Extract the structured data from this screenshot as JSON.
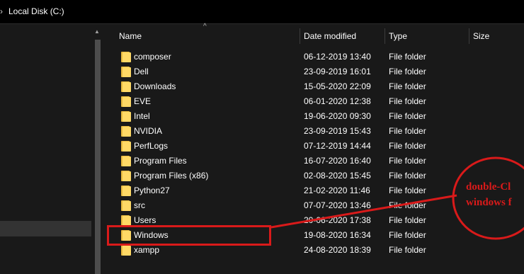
{
  "breadcrumb": {
    "chevron": "›",
    "location": "Local Disk (C:)"
  },
  "columns": {
    "name": "Name",
    "date_modified": "Date modified",
    "type": "Type",
    "size": "Size",
    "sort_indicator": "^"
  },
  "rows": [
    {
      "name": "composer",
      "date": "06-12-2019 13:40",
      "type": "File folder"
    },
    {
      "name": "Dell",
      "date": "23-09-2019 16:01",
      "type": "File folder"
    },
    {
      "name": "Downloads",
      "date": "15-05-2020 22:09",
      "type": "File folder"
    },
    {
      "name": "EVE",
      "date": "06-01-2020 12:38",
      "type": "File folder"
    },
    {
      "name": "Intel",
      "date": "19-06-2020 09:30",
      "type": "File folder"
    },
    {
      "name": "NVIDIA",
      "date": "23-09-2019 15:43",
      "type": "File folder"
    },
    {
      "name": "PerfLogs",
      "date": "07-12-2019 14:44",
      "type": "File folder"
    },
    {
      "name": "Program Files",
      "date": "16-07-2020 16:40",
      "type": "File folder"
    },
    {
      "name": "Program Files (x86)",
      "date": "02-08-2020 15:45",
      "type": "File folder"
    },
    {
      "name": "Python27",
      "date": "21-02-2020 11:46",
      "type": "File folder"
    },
    {
      "name": "src",
      "date": "07-07-2020 13:46",
      "type": "File folder"
    },
    {
      "name": "Users",
      "date": "20-06-2020 17:38",
      "type": "File folder"
    },
    {
      "name": "Windows",
      "date": "19-08-2020 16:34",
      "type": "File folder"
    },
    {
      "name": "xampp",
      "date": "24-08-2020 18:39",
      "type": "File folder"
    }
  ],
  "annotation": {
    "line1": "double-Cl",
    "line2": "windows f",
    "color": "#d91a1a"
  },
  "colors": {
    "background": "#191919",
    "header_bar": "#000000",
    "folder_yellow": "#ffd966",
    "selected": "#333333"
  },
  "icons": {
    "folder": "folder-icon",
    "scroll_up": "scroll-up-arrow-icon"
  }
}
